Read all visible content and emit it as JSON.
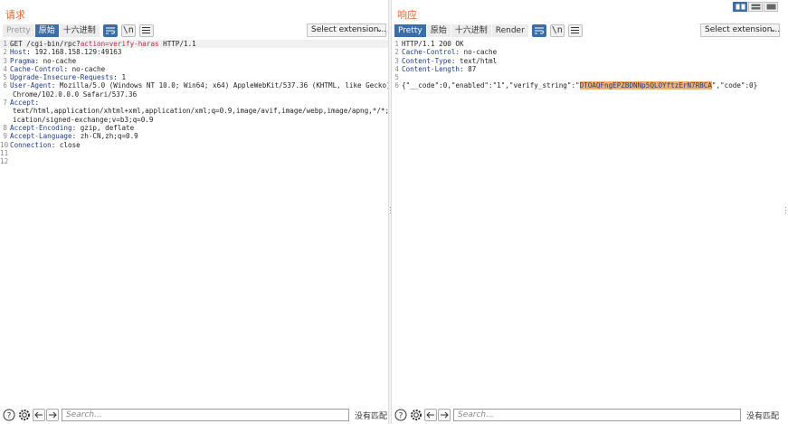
{
  "request": {
    "title": "请求",
    "tabs": [
      {
        "label": "Pretty",
        "state": "disabled"
      },
      {
        "label": "原始",
        "state": "active"
      },
      {
        "label": "十六进制",
        "state": "normal"
      }
    ],
    "icons": {
      "wrap": "wrap-lines-icon",
      "newline": "\\n",
      "menu": "hamburger-menu-icon"
    },
    "select_extension": "Select extension...",
    "lines": [
      {
        "n": "1",
        "parts": [
          [
            "t",
            "GET /cgi-bin/rpc?"
          ],
          [
            "k",
            "action=verify-haras"
          ],
          [
            "t",
            " HTTP/1.1"
          ]
        ]
      },
      {
        "n": "2",
        "parts": [
          [
            "h",
            "Host"
          ],
          [
            "t",
            ": 192.168.158.129:49163"
          ]
        ]
      },
      {
        "n": "3",
        "parts": [
          [
            "h",
            "Pragma"
          ],
          [
            "t",
            ": no-cache"
          ]
        ]
      },
      {
        "n": "4",
        "parts": [
          [
            "h",
            "Cache-Control"
          ],
          [
            "t",
            ": no-cache"
          ]
        ]
      },
      {
        "n": "5",
        "parts": [
          [
            "h",
            "Upgrade-Insecure-Requests"
          ],
          [
            "t",
            ": 1"
          ]
        ]
      },
      {
        "n": "6",
        "parts": [
          [
            "h",
            "User-Agent"
          ],
          [
            "t",
            ": Mozilla/5.0 (Windows NT 10.0; Win64; x64) AppleWebKit/537.36 (KHTML, like Gecko)"
          ]
        ],
        "cont": [
          "Chrome/102.0.0.0 Safari/537.36"
        ]
      },
      {
        "n": "7",
        "parts": [
          [
            "h",
            "Accept"
          ],
          [
            "t",
            ":"
          ]
        ],
        "cont": [
          "text/html,application/xhtml+xml,application/xml;q=0.9,image/avif,image/webp,image/apng,*/*;q=0.8,appl",
          "ication/signed-exchange;v=b3;q=0.9"
        ]
      },
      {
        "n": "8",
        "parts": [
          [
            "h",
            "Accept-Encoding"
          ],
          [
            "t",
            ": gzip, deflate"
          ]
        ]
      },
      {
        "n": "9",
        "parts": [
          [
            "h",
            "Accept-Language"
          ],
          [
            "t",
            ": zh-CN,zh;q=0.9"
          ]
        ]
      },
      {
        "n": "10",
        "parts": [
          [
            "h",
            "Connection"
          ],
          [
            "t",
            ": close"
          ]
        ]
      },
      {
        "n": "11",
        "parts": []
      },
      {
        "n": "12",
        "parts": []
      }
    ],
    "search_placeholder": "Search...",
    "no_match": "没有匹配"
  },
  "response": {
    "title": "响应",
    "tabs": [
      {
        "label": "Pretty",
        "state": "active"
      },
      {
        "label": "原始",
        "state": "normal"
      },
      {
        "label": "十六进制",
        "state": "normal"
      },
      {
        "label": "Render",
        "state": "normal"
      }
    ],
    "icons": {
      "wrap": "wrap-lines-icon",
      "newline": "\\n",
      "menu": "hamburger-menu-icon"
    },
    "select_extension": "Select extension...",
    "lines": [
      {
        "n": "1",
        "parts": [
          [
            "t",
            "HTTP/1.1 200 OK"
          ]
        ]
      },
      {
        "n": "2",
        "parts": [
          [
            "h",
            "Cache-Control"
          ],
          [
            "t",
            ": no-cache"
          ]
        ]
      },
      {
        "n": "3",
        "parts": [
          [
            "h",
            "Content-Type"
          ],
          [
            "t",
            ": text/html"
          ]
        ]
      },
      {
        "n": "4",
        "parts": [
          [
            "h",
            "Content-Length"
          ],
          [
            "t",
            ": 87"
          ]
        ]
      },
      {
        "n": "5",
        "parts": []
      },
      {
        "n": "6",
        "parts": [
          [
            "t",
            "{\"__code\":0,\"enabled\":\"1\",\"verify_string\":\""
          ],
          [
            "x",
            "DTOAQFngEPZBDNNp5QLOYftzErN7RBCA"
          ],
          [
            "t",
            "\",\"code\":0}"
          ]
        ]
      }
    ],
    "search_placeholder": "Search...",
    "no_match": "没有匹配"
  },
  "view_modes": [
    "side-by-side-view-icon",
    "stacked-view-icon",
    "single-view-icon"
  ]
}
